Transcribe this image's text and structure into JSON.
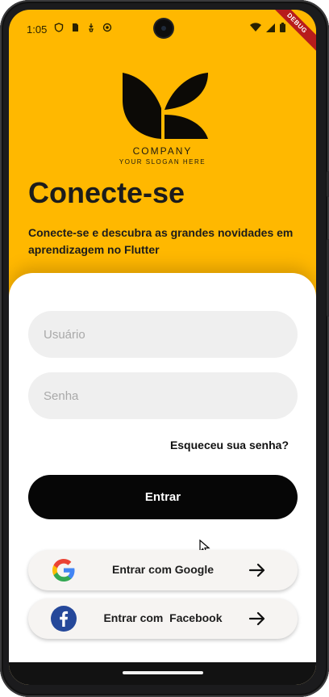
{
  "status_bar": {
    "time": "1:05",
    "left_icons": [
      "shield-icon",
      "sim-card-icon",
      "battery-saver-icon",
      "sync-icon"
    ],
    "right_icons": [
      "wifi-icon",
      "signal-icon",
      "battery-icon"
    ],
    "debug_banner": "DEBUG"
  },
  "header": {
    "brand_name": "COMPANY",
    "brand_slogan": "YOUR SLOGAN HERE",
    "title": "Conecte-se",
    "subtitle": "Conecte-se e descubra as grandes novidades em aprendizagem no Flutter"
  },
  "login": {
    "username_placeholder": "Usuário",
    "username_value": "",
    "password_placeholder": "Senha",
    "password_value": "",
    "forgot_label": "Esqueceu sua senha?",
    "submit_label": "Entrar"
  },
  "social": {
    "google_label": "Entrar com Google",
    "facebook_label": "Entrar com  Facebook"
  },
  "colors": {
    "background_yellow": "#ffb800",
    "submit_button": "#060606",
    "input_bg": "#efefef",
    "facebook_blue": "#25489a"
  }
}
